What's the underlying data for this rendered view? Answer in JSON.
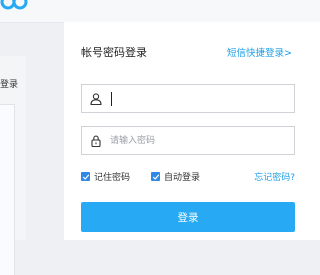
{
  "partial_left": {
    "text": "登录"
  },
  "login": {
    "title": "帐号密码登录",
    "sms_link": "短信快捷登录>",
    "username": {
      "value": "",
      "placeholder": ""
    },
    "password": {
      "value": "",
      "placeholder": "请输入密码"
    },
    "remember_password": {
      "label": "记住密码",
      "checked": true
    },
    "auto_login": {
      "label": "自动登录",
      "checked": true
    },
    "forgot_password": "忘记密码?",
    "submit": "登录"
  },
  "colors": {
    "accent": "#27a9f3",
    "link": "#1e9fe6",
    "checkbox": "#2f87e8"
  },
  "icons": {
    "logo": "logo-icon",
    "user": "user-icon",
    "lock": "lock-icon",
    "check": "check-icon"
  }
}
